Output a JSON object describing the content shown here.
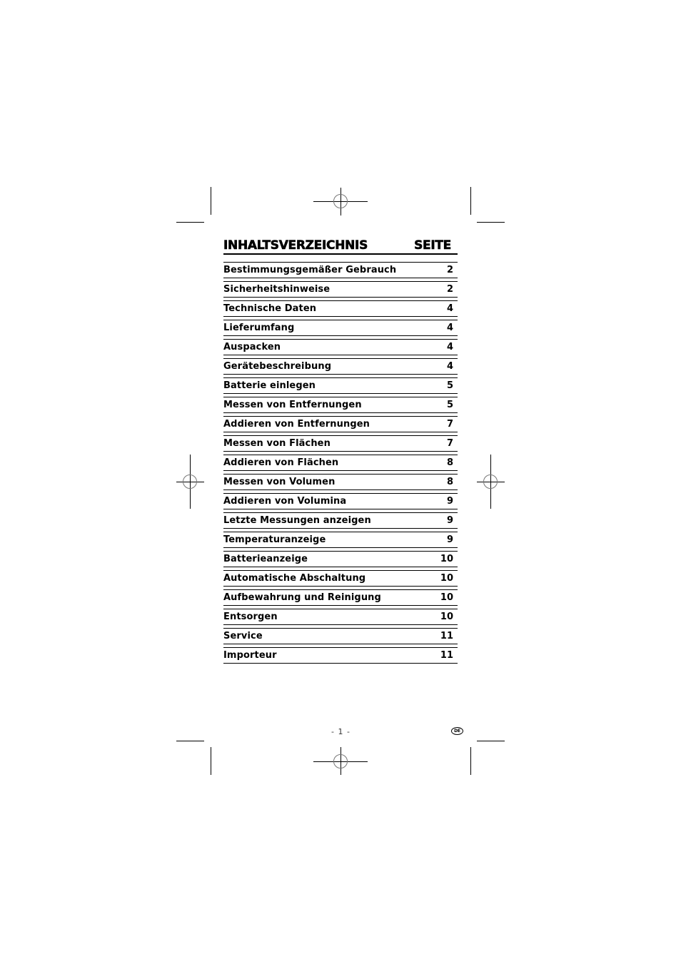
{
  "toc": {
    "title": "INHALTSVERZEICHNIS",
    "page_header": "SEITE",
    "entries": [
      {
        "label": "Bestimmungsgemäßer Gebrauch",
        "page": "2"
      },
      {
        "label": "Sicherheitshinweise",
        "page": "2"
      },
      {
        "label": "Technische Daten",
        "page": "4"
      },
      {
        "label": "Lieferumfang",
        "page": "4"
      },
      {
        "label": "Auspacken",
        "page": "4"
      },
      {
        "label": "Gerätebeschreibung",
        "page": "4"
      },
      {
        "label": "Batterie einlegen",
        "page": "5"
      },
      {
        "label": "Messen von Entfernungen",
        "page": "5"
      },
      {
        "label": "Addieren von Entfernungen",
        "page": "7"
      },
      {
        "label": "Messen von Flächen",
        "page": "7"
      },
      {
        "label": "Addieren von Flächen",
        "page": "8"
      },
      {
        "label": "Messen von Volumen",
        "page": "8"
      },
      {
        "label": "Addieren von Volumina",
        "page": "9"
      },
      {
        "label": "Letzte Messungen anzeigen",
        "page": "9"
      },
      {
        "label": "Temperaturanzeige",
        "page": "9"
      },
      {
        "label": "Batterieanzeige",
        "page": "10"
      },
      {
        "label": "Automatische Abschaltung",
        "page": "10"
      },
      {
        "label": "Aufbewahrung und Reinigung",
        "page": "10"
      },
      {
        "label": "Entsorgen",
        "page": "10"
      },
      {
        "label": "Service",
        "page": "11"
      },
      {
        "label": "Importeur",
        "page": "11"
      }
    ]
  },
  "footer": {
    "page_number": "- 1 -",
    "language_badge": "DE"
  }
}
